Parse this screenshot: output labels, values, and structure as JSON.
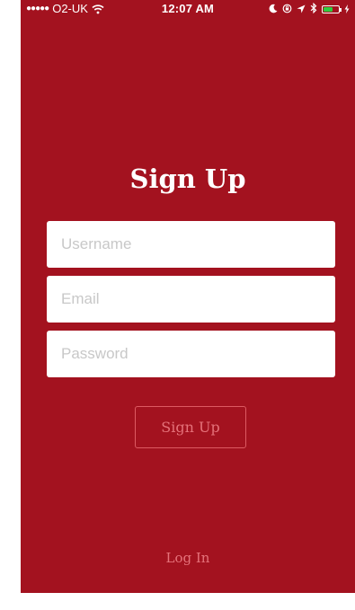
{
  "status_bar": {
    "signal": "●●●●●",
    "carrier": "O2-UK",
    "time": "12:07 AM",
    "wifi_icon": "wifi-icon",
    "moon_icon": "moon-icon",
    "lock_rotation_icon": "orientation-lock-icon",
    "location_icon": "location-arrow-icon",
    "bluetooth_icon": "bluetooth-icon",
    "battery_icon": "battery-icon",
    "charging_icon": "charging-bolt-icon",
    "battery_level": 0.6
  },
  "form": {
    "title": "Sign Up",
    "username": {
      "value": "",
      "placeholder": "Username"
    },
    "email": {
      "value": "",
      "placeholder": "Email"
    },
    "password": {
      "value": "",
      "placeholder": "Password"
    },
    "submit_label": "Sign Up"
  },
  "footer": {
    "login_label": "Log In"
  },
  "colors": {
    "background": "#a3121f",
    "field_background": "#ffffff",
    "placeholder": "#c8c8c8",
    "button_border": "#dd5a62",
    "button_text": "#e5727a",
    "battery_fill": "#2ecc40"
  }
}
